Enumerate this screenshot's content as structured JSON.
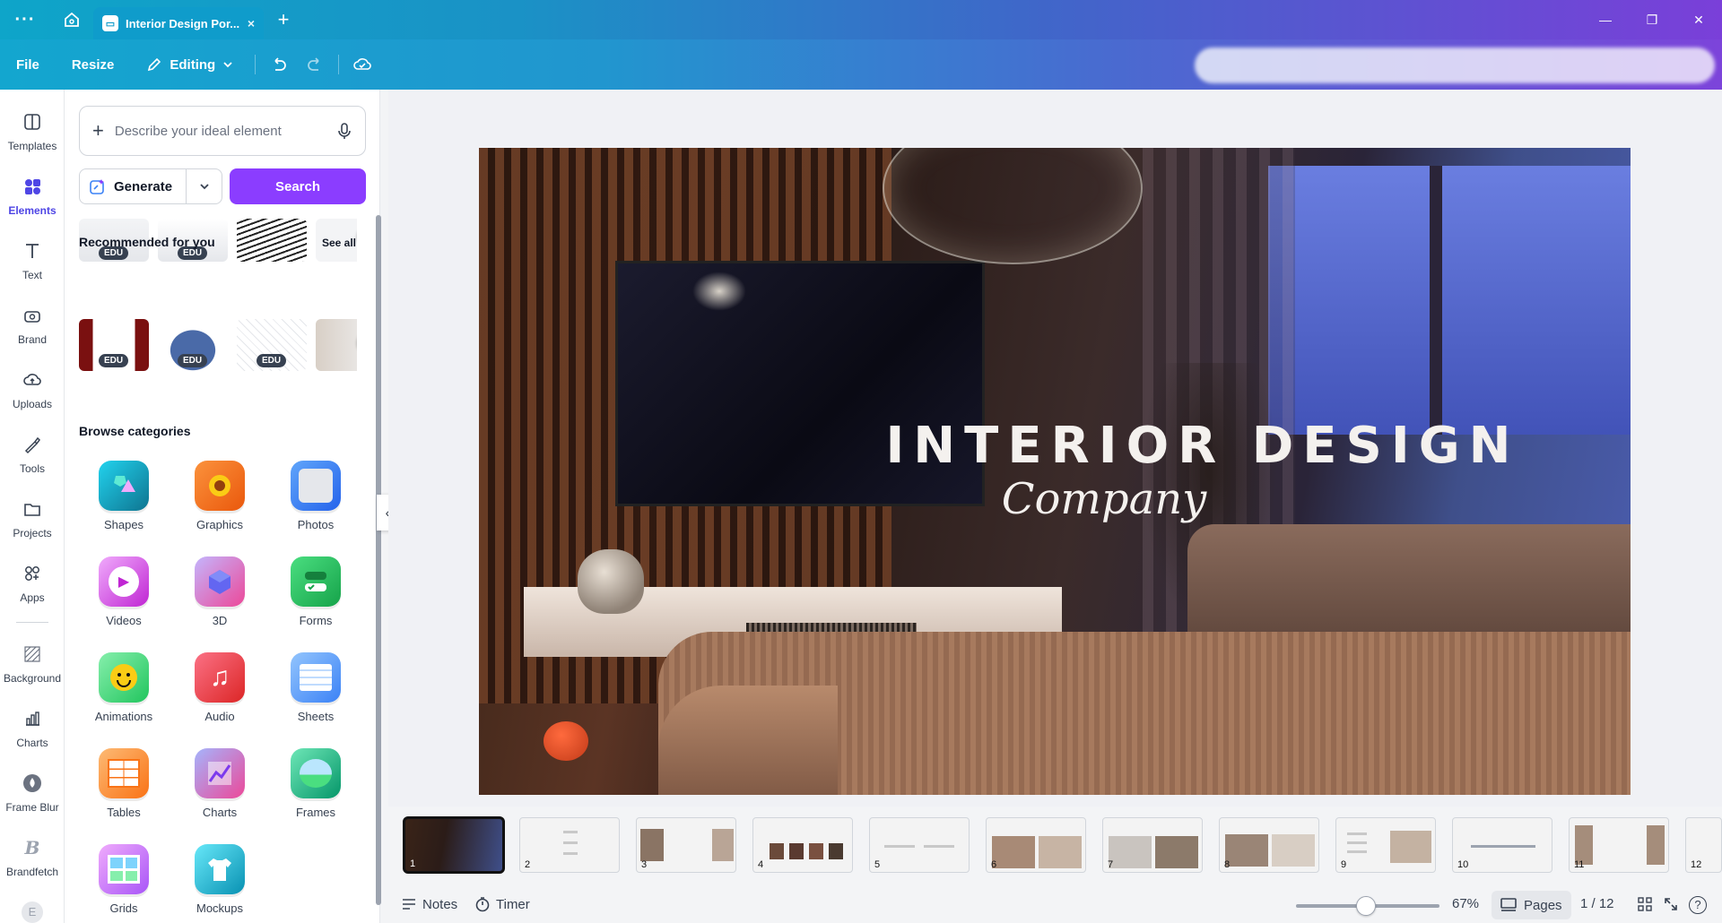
{
  "titlebar": {
    "menu_icon": "more-horizontal-icon",
    "tab_title": "Interior Design Por...",
    "tab_close": "×",
    "new_tab": "+"
  },
  "toolbar": {
    "file": "File",
    "resize": "Resize",
    "editing": "Editing"
  },
  "rail": {
    "items": [
      {
        "label": "Templates",
        "icon": "templates-icon"
      },
      {
        "label": "Elements",
        "icon": "elements-icon"
      },
      {
        "label": "Text",
        "icon": "text-icon"
      },
      {
        "label": "Brand",
        "icon": "brand-icon"
      },
      {
        "label": "Uploads",
        "icon": "uploads-icon"
      },
      {
        "label": "Tools",
        "icon": "tools-icon"
      },
      {
        "label": "Projects",
        "icon": "projects-icon"
      },
      {
        "label": "Apps",
        "icon": "apps-icon"
      },
      {
        "label": "Background",
        "icon": "background-icon"
      },
      {
        "label": "Charts",
        "icon": "charts-icon"
      },
      {
        "label": "Frame Blur",
        "icon": "frame-blur-icon"
      },
      {
        "label": "Brandfetch",
        "icon": "brandfetch-icon"
      }
    ]
  },
  "panel": {
    "search_placeholder": "Describe your ideal element",
    "generate": "Generate",
    "search": "Search",
    "edu_badge": "EDU",
    "recommended_title": "Recommended for you",
    "see_all": "See all",
    "browse_title": "Browse categories",
    "categories": [
      "Shapes",
      "Graphics",
      "Photos",
      "Videos",
      "3D",
      "Forms",
      "Animations",
      "Audio",
      "Sheets",
      "Tables",
      "Charts",
      "Frames",
      "Grids",
      "Mockups"
    ]
  },
  "slide": {
    "title": "INTERIOR DESIGN",
    "subtitle": "Company"
  },
  "filmstrip": {
    "pages": [
      "1",
      "2",
      "3",
      "4",
      "5",
      "6",
      "7",
      "8",
      "9",
      "10",
      "11",
      "12"
    ],
    "selected": 1
  },
  "bottombar": {
    "notes": "Notes",
    "timer": "Timer",
    "zoom": "67%",
    "pages": "Pages",
    "page_count": "1 / 12",
    "help": "?"
  },
  "colors": {
    "accent": "#8b3dff",
    "active_rail": "#4f46e5"
  }
}
